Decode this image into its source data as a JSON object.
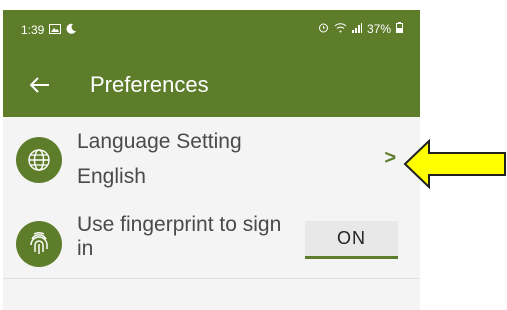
{
  "status_bar": {
    "time": "1:39",
    "battery": "37%"
  },
  "app_bar": {
    "title": "Preferences",
    "back_icon": "arrow-left-icon"
  },
  "settings": {
    "language": {
      "icon": "globe-icon",
      "title": "Language Setting",
      "value": "English",
      "chevron": ">"
    },
    "fingerprint": {
      "icon": "fingerprint-icon",
      "title": "Use fingerprint to sign in",
      "toggle_label": "ON"
    }
  },
  "colors": {
    "primary": "#5d7d2b",
    "background": "#f4f4f4",
    "annotation_arrow": "#ffff00"
  }
}
